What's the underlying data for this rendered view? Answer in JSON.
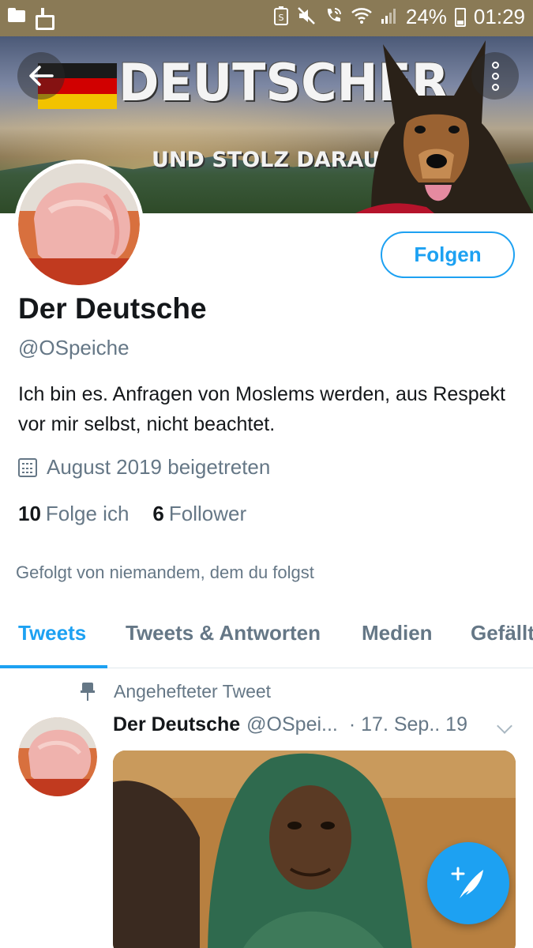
{
  "status_bar": {
    "battery_percent": "24%",
    "time": "01:29",
    "icons": [
      "folder-icon",
      "cleaner-icon",
      "battery-saver-icon",
      "mute-icon",
      "wifi-call-icon",
      "wifi-icon",
      "signal-icon",
      "battery-icon"
    ]
  },
  "banner": {
    "title": "DEUTSCHER",
    "subtitle": "UND STOLZ DARAUF",
    "flag_colors": [
      "#1a1a1a",
      "#d10000",
      "#f2c300"
    ]
  },
  "actions": {
    "back_icon": "arrow-left-icon",
    "more_icon": "more-vertical-icon",
    "follow_label": "Folgen"
  },
  "profile": {
    "display_name": "Der Deutsche",
    "handle": "@OSpeiche",
    "bio": "Ich bin es. Anfragen von Moslems werden, aus Respekt vor mir selbst, nicht beachtet.",
    "joined": "August 2019 beigetreten",
    "following_count": "10",
    "following_label": "Folge ich",
    "followers_count": "6",
    "followers_label": "Follower",
    "followed_by": "Gefolgt von niemandem, dem du folgst"
  },
  "tabs": [
    {
      "label": "Tweets",
      "active": true
    },
    {
      "label": "Tweets & Antworten",
      "active": false
    },
    {
      "label": "Medien",
      "active": false
    },
    {
      "label": "Gefällt",
      "active": false
    }
  ],
  "pinned_tweet": {
    "pinned_label": "Angehefteter Tweet",
    "author_name": "Der Deutsche",
    "author_handle": "@OSpei...",
    "date": "· 17. Sep.. 19"
  },
  "colors": {
    "accent": "#1da1f2",
    "text_primary": "#14171a",
    "text_secondary": "#657786",
    "status_bar": "#8a7a56"
  },
  "fab": {
    "icon": "compose-tweet-icon"
  }
}
